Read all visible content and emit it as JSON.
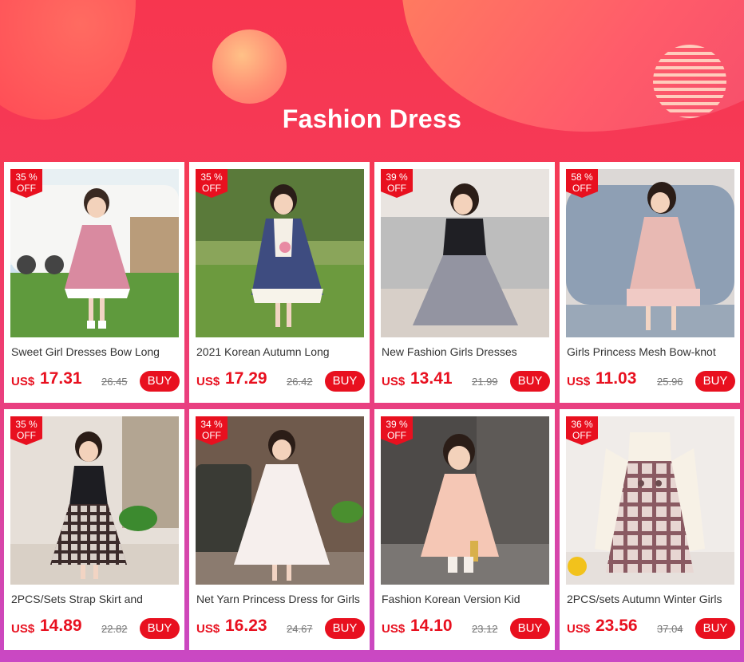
{
  "banner": {
    "title": "Fashion Dress"
  },
  "currency": "US$",
  "buy_label": "BUY",
  "products": [
    {
      "discount": "35 %",
      "off": "OFF",
      "name": "Sweet Girl Dresses Bow Long",
      "price": "17.31",
      "old_price": "26.45",
      "image": "girl-pink-dress-caravan"
    },
    {
      "discount": "35 %",
      "off": "OFF",
      "name": "2021 Korean Autumn Long",
      "price": "17.29",
      "old_price": "26.42",
      "image": "girl-navy-lace-dress-field"
    },
    {
      "discount": "39 %",
      "off": "OFF",
      "name": "New Fashion Girls Dresses",
      "price": "13.41",
      "old_price": "21.99",
      "image": "girl-black-tulle-dress-sofa"
    },
    {
      "discount": "58 %",
      "off": "OFF",
      "name": "Girls Princess Mesh Bow-knot",
      "price": "11.03",
      "old_price": "25.96",
      "image": "girl-pink-ruffle-dress-armchair"
    },
    {
      "discount": "35 %",
      "off": "OFF",
      "name": "2PCS/Sets Strap Skirt and",
      "price": "14.89",
      "old_price": "22.82",
      "image": "girl-plaid-strap-skirt-black-top"
    },
    {
      "discount": "34 %",
      "off": "OFF",
      "name": "Net Yarn Princess Dress for Girls",
      "price": "16.23",
      "old_price": "24.67",
      "image": "girl-white-net-dress-sofa"
    },
    {
      "discount": "39 %",
      "off": "OFF",
      "name": "Fashion Korean Version Kid",
      "price": "14.10",
      "old_price": "23.12",
      "image": "girl-peach-tulle-dress"
    },
    {
      "discount": "36 %",
      "off": "OFF",
      "name": "2PCS/sets Autumn Winter Girls",
      "price": "23.56",
      "old_price": "37.04",
      "image": "plaid-pinafore-dress-white-top"
    }
  ]
}
